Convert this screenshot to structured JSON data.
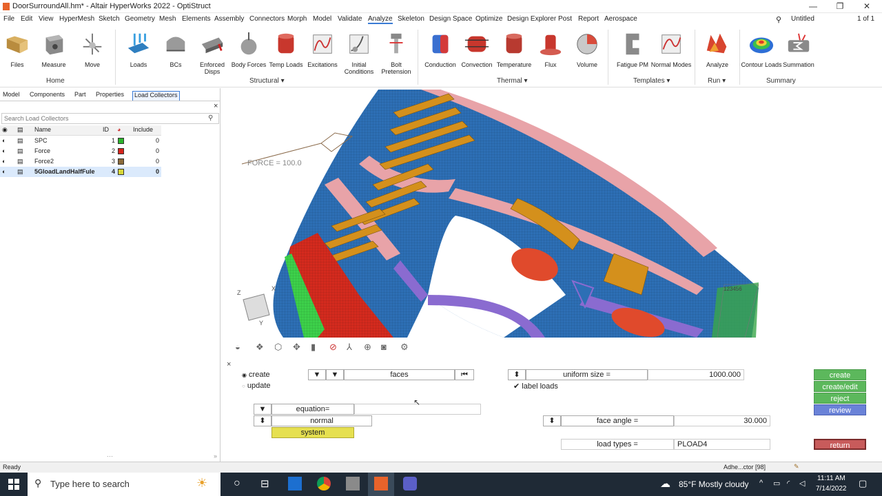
{
  "window": {
    "title": "DoorSurroundAll.hm* - Altair HyperWorks 2022 - OptiStruct",
    "minimize": "—",
    "restore": "❐",
    "close": "✕"
  },
  "menubar": {
    "items": [
      "File",
      "Edit",
      "View",
      "HyperMesh",
      "Sketch",
      "Geometry",
      "Mesh",
      "Elements",
      "Assembly",
      "Connectors",
      "Morph",
      "Model",
      "Validate",
      "Analyze",
      "Skeleton",
      "Design Space",
      "Optimize",
      "Design Explorer",
      "Post",
      "Report",
      "Aerospace"
    ],
    "active": "Analyze",
    "right": {
      "session": "Untitled",
      "pages": "1 of 1"
    }
  },
  "ribbon": {
    "buttons": [
      {
        "label": "Files",
        "icon": "folder-icon"
      },
      {
        "label": "Measure",
        "icon": "measure-icon"
      },
      {
        "label": "Move",
        "icon": "move-icon"
      },
      {
        "label": "Loads",
        "icon": "loads-icon"
      },
      {
        "label": "BCs",
        "icon": "bcs-icon"
      },
      {
        "label": "Enforced Disps",
        "icon": "enforced-disps-icon"
      },
      {
        "label": "Body Forces",
        "icon": "body-forces-icon"
      },
      {
        "label": "Temp Loads",
        "icon": "temp-loads-icon"
      },
      {
        "label": "Excitations",
        "icon": "excitations-icon"
      },
      {
        "label": "Initial Conditions",
        "icon": "initial-conditions-icon"
      },
      {
        "label": "Bolt Pretension",
        "icon": "bolt-pretension-icon"
      },
      {
        "label": "Conduction",
        "icon": "conduction-icon"
      },
      {
        "label": "Convection",
        "icon": "convection-icon"
      },
      {
        "label": "Temperature",
        "icon": "temperature-icon"
      },
      {
        "label": "Flux",
        "icon": "flux-icon"
      },
      {
        "label": "Volume",
        "icon": "volume-icon"
      },
      {
        "label": "Fatigue PM",
        "icon": "fatigue-pm-icon"
      },
      {
        "label": "Normal Modes",
        "icon": "normal-modes-icon"
      },
      {
        "label": "Analyze",
        "icon": "analyze-icon"
      },
      {
        "label": "Contour Loads",
        "icon": "contour-loads-icon"
      },
      {
        "label": "Summation",
        "icon": "summation-icon"
      }
    ],
    "groups": {
      "home": "Home",
      "structural": "Structural",
      "thermal": "Thermal",
      "templates": "Templates",
      "run": "Run",
      "summary": "Summary"
    }
  },
  "panel": {
    "tabs": [
      "Model",
      "Components",
      "Part",
      "Properties",
      "Load Collectors"
    ],
    "active_tab": "Load Collectors",
    "search_placeholder": "Search Load Collectors",
    "columns": {
      "name": "Name",
      "id": "ID",
      "include": "Include"
    },
    "rows": [
      {
        "name": "SPC",
        "id": "1",
        "color": "#2db52d",
        "include": "0"
      },
      {
        "name": "Force",
        "id": "2",
        "color": "#d6241c",
        "include": "0"
      },
      {
        "name": "Force2",
        "id": "3",
        "color": "#8b6a3a",
        "include": "0"
      },
      {
        "name": "5GloadLandHalfFule",
        "id": "4",
        "color": "#d8d83a",
        "include": "0",
        "selected": true
      }
    ]
  },
  "viewport": {
    "force_label": "FORCE = 100.0",
    "triad": {
      "x": "X",
      "y": "Y",
      "z": "Z"
    },
    "corner_label": "123456"
  },
  "loads_panel": {
    "create": "create",
    "update": "update",
    "entity": "faces",
    "uniform_size_label": "uniform size =",
    "uniform_size_value": "1000.000",
    "label_loads": "label loads",
    "equation_label": "equation=",
    "equation_value": "",
    "normal_label": "normal",
    "system_label": "system",
    "face_angle_label": "face angle =",
    "face_angle_value": "30.000",
    "load_types_label": "load types =",
    "load_types_value": "PLOAD4",
    "buttons": {
      "create": "create",
      "create_edit": "create/edit",
      "reject": "reject",
      "review": "review",
      "return": "return"
    }
  },
  "status": {
    "left": "Ready",
    "right": "Adhe...ctor [98]"
  },
  "taskbar": {
    "search_placeholder": "Type here to search",
    "weather": "85°F  Mostly cloudy",
    "time": "11:11 AM",
    "date": "7/14/2022"
  }
}
